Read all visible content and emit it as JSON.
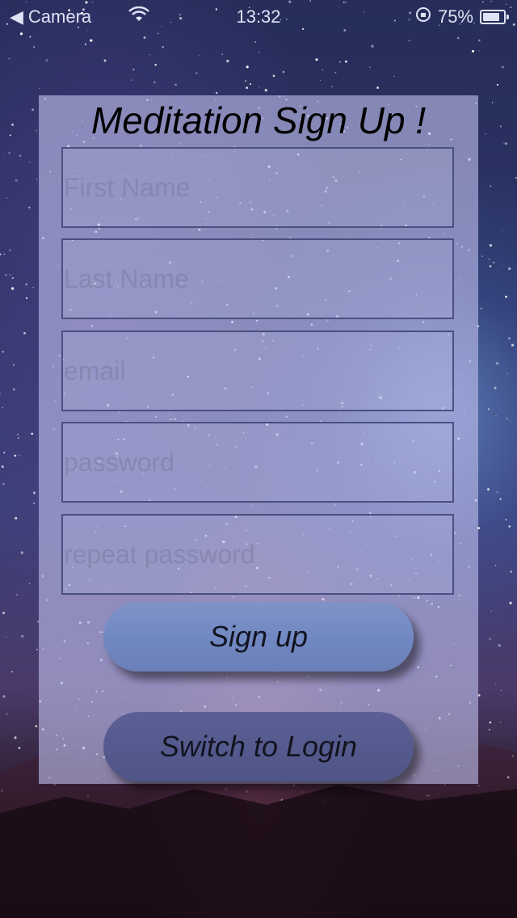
{
  "status_bar": {
    "back_label": "Camera",
    "time": "13:32",
    "battery_percent": "75%"
  },
  "form": {
    "title": "Meditation Sign Up !",
    "fields": [
      {
        "placeholder": "First Name",
        "value": ""
      },
      {
        "placeholder": "Last Name",
        "value": ""
      },
      {
        "placeholder": "email",
        "value": ""
      },
      {
        "placeholder": "password",
        "value": ""
      },
      {
        "placeholder": "repeat password",
        "value": ""
      }
    ],
    "signup_label": "Sign up",
    "switch_label": "Switch to Login"
  },
  "colors": {
    "card_tint": "#bebeeb",
    "field_border": "#4a5080",
    "signup_button": "#7389c2",
    "switch_button": "#545a8c"
  },
  "icons": [
    "back-arrow-icon",
    "wifi-icon",
    "rotation-lock-icon",
    "battery-icon"
  ]
}
